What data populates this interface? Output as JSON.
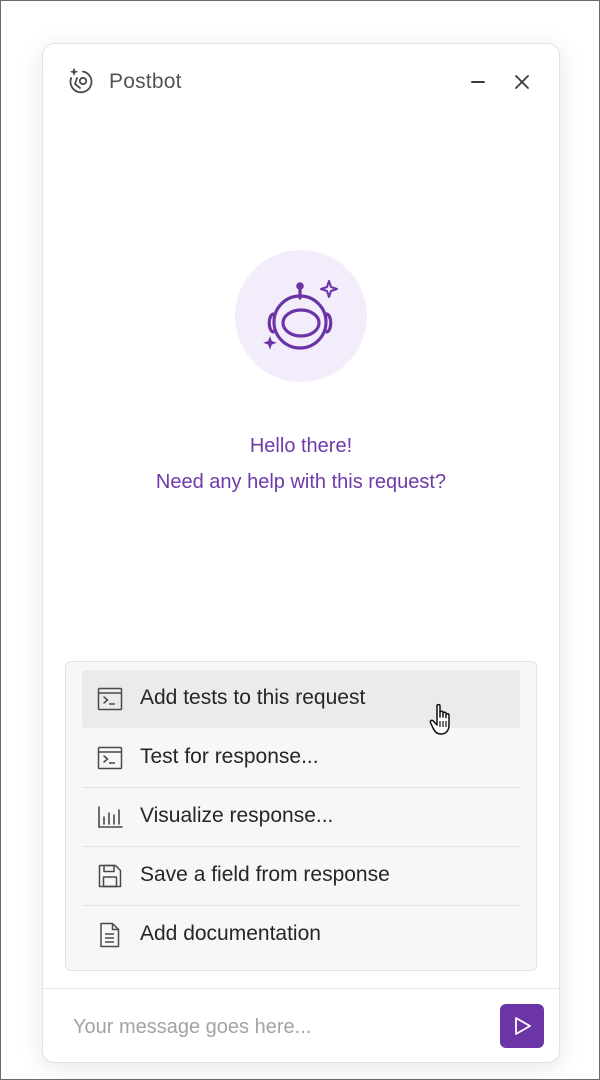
{
  "header": {
    "title": "Postbot",
    "icons": {
      "logo": "postbot-logo-icon",
      "minimize": "minus-icon",
      "close": "close-icon"
    }
  },
  "welcome": {
    "line1": "Hello there!",
    "line2": "Need any help with this request?"
  },
  "suggestions": [
    {
      "label": "Add tests to this request",
      "icon": "terminal-icon",
      "active": true
    },
    {
      "label": "Test for response...",
      "icon": "terminal-icon",
      "active": false
    },
    {
      "label": "Visualize response...",
      "icon": "bar-chart-icon",
      "active": false
    },
    {
      "label": "Save a field from response",
      "icon": "save-icon",
      "active": false
    },
    {
      "label": "Add documentation",
      "icon": "document-icon",
      "active": false
    }
  ],
  "composer": {
    "placeholder": "Your message goes here...",
    "value": "",
    "send_icon": "send-icon"
  },
  "colors": {
    "accent": "#6b35a6",
    "greeting_text": "#6e3aa8",
    "avatar_bg": "#f3edfb"
  }
}
